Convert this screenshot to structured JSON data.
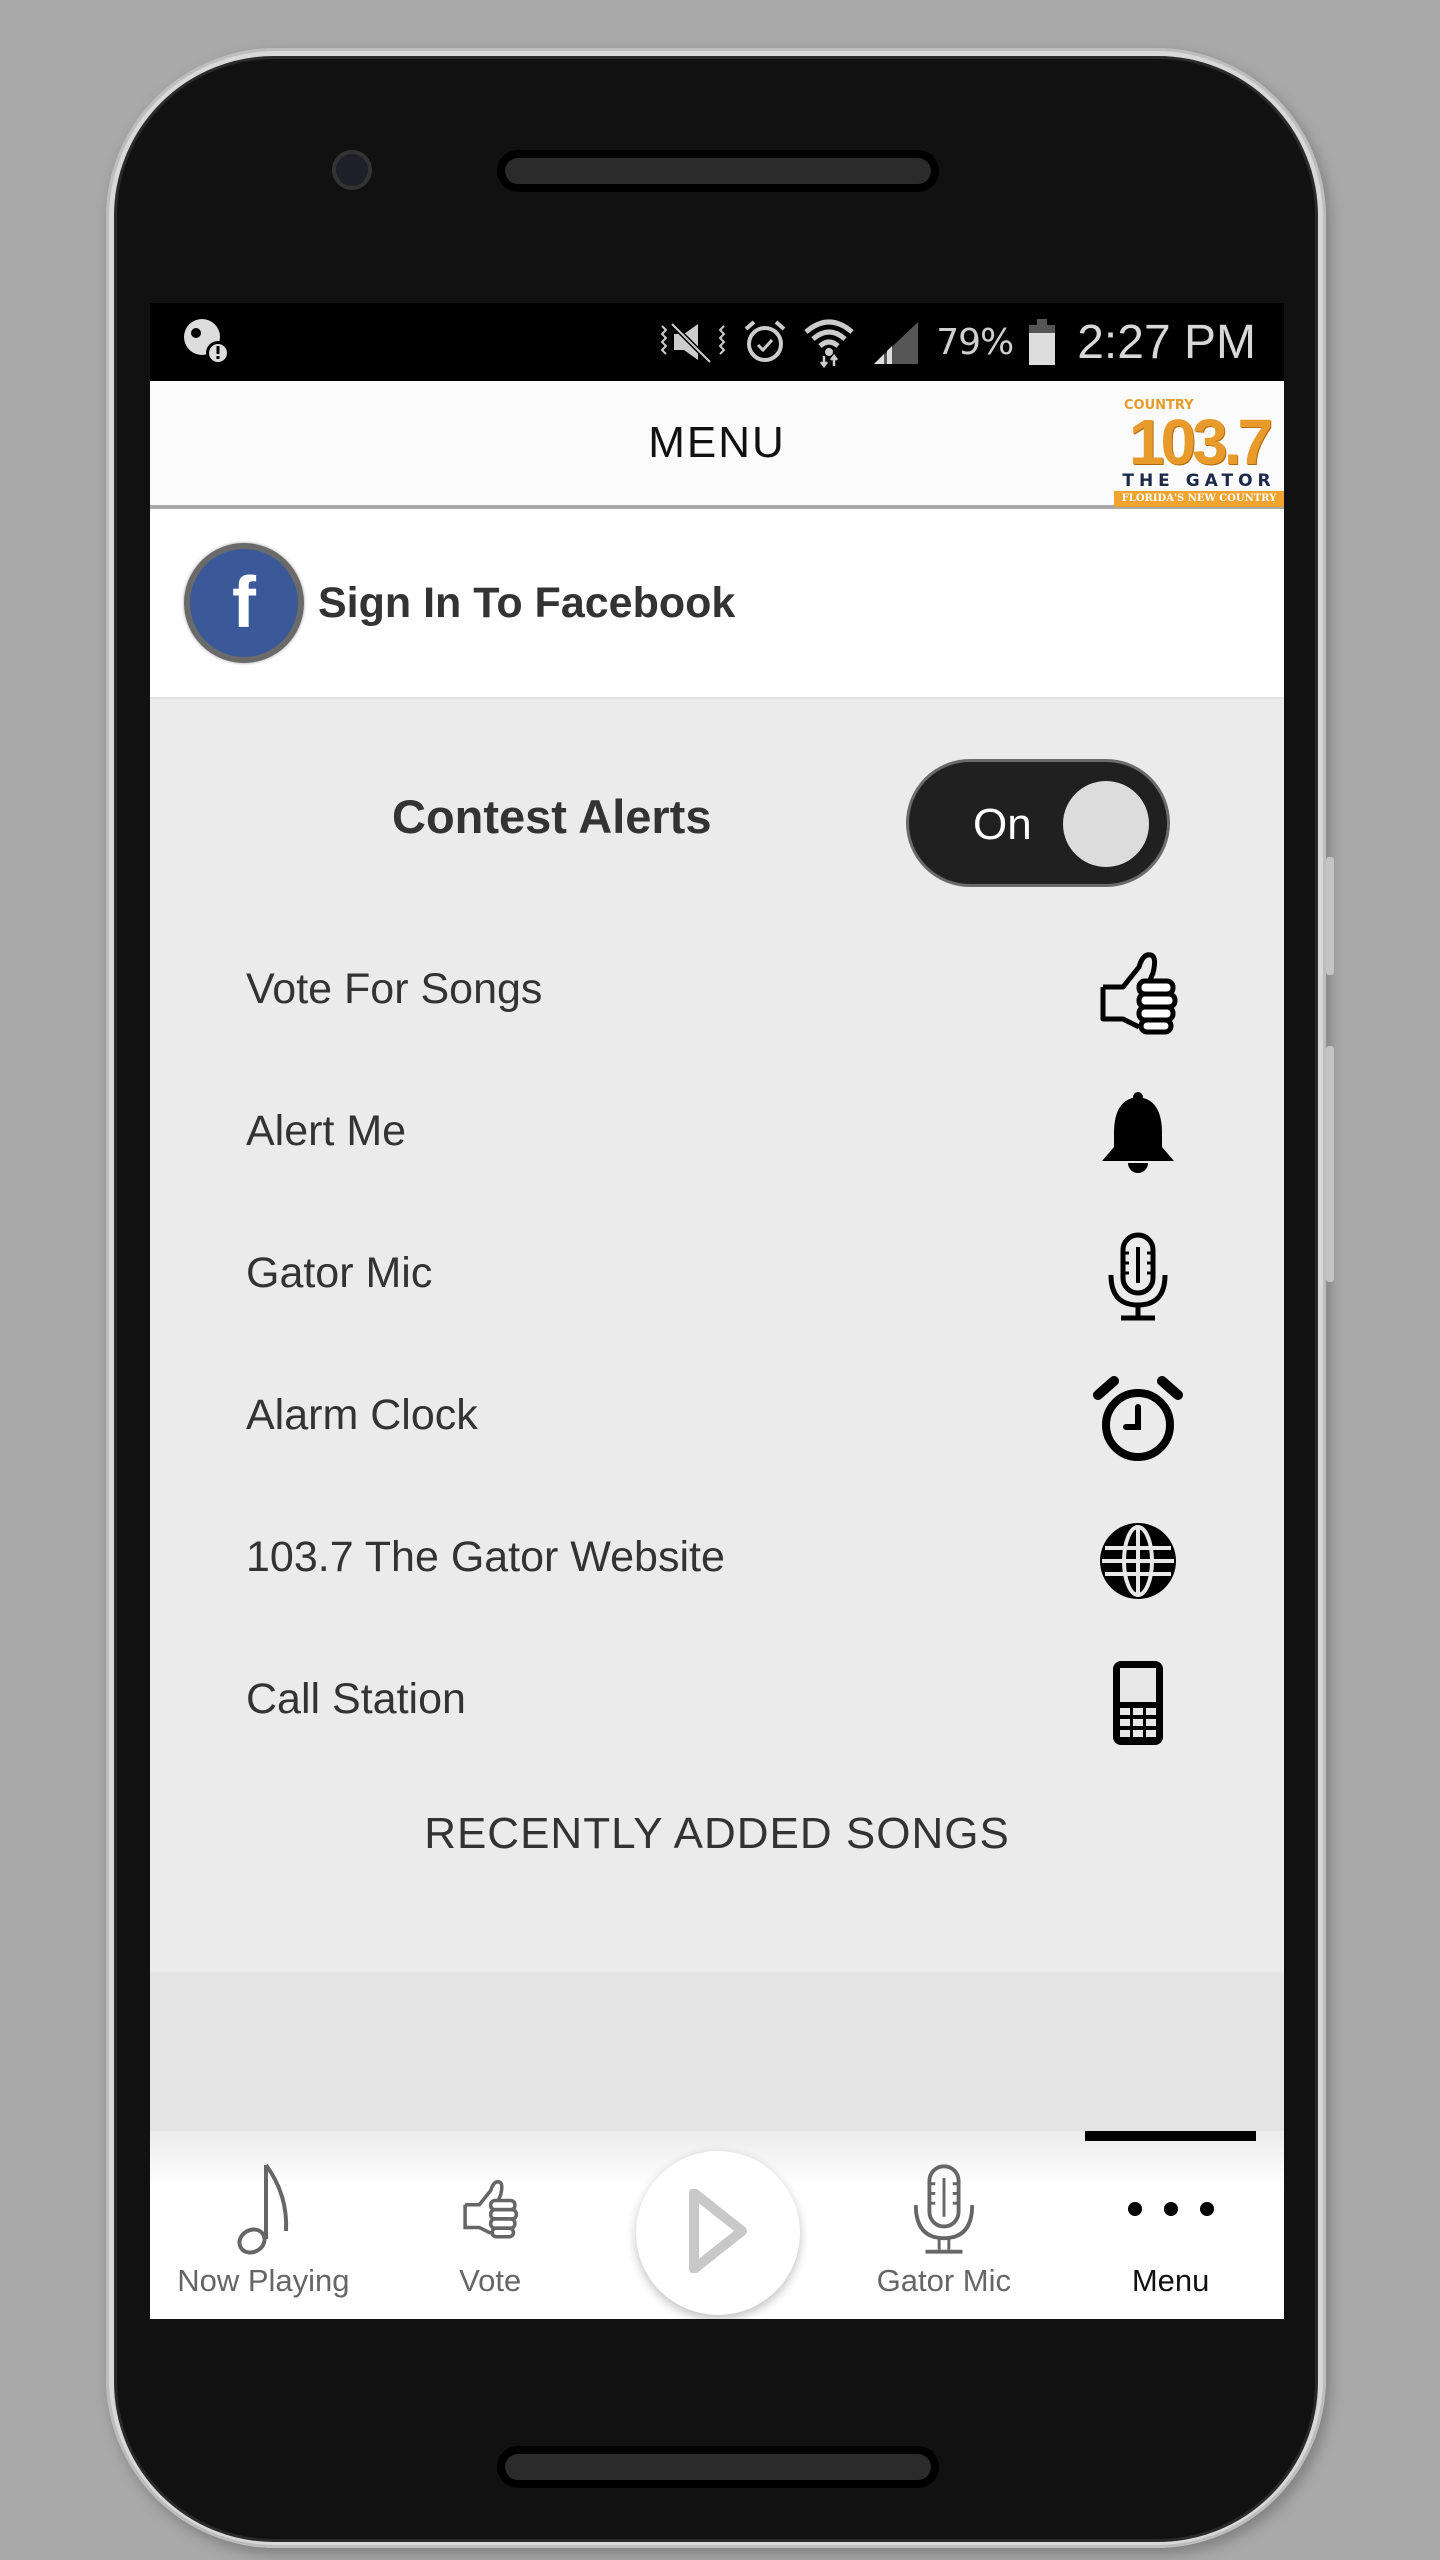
{
  "status_bar": {
    "left_icon": "data-saver-alert-icon",
    "icons": [
      "vibrate-mute-icon",
      "alarm-icon",
      "wifi-icon",
      "signal-icon"
    ],
    "battery_percent": "79%",
    "battery_icon": "battery-icon",
    "time": "2:27 PM"
  },
  "header": {
    "title": "MENU",
    "logo": {
      "country": "COUNTRY",
      "frequency": "103.7",
      "name": "THE GATOR",
      "tagline": "FLORIDA'S NEW COUNTRY"
    }
  },
  "facebook": {
    "label": "Sign In To Facebook",
    "icon_letter": "f",
    "color": "#3b5998"
  },
  "contest_alerts": {
    "label": "Contest Alerts",
    "toggle_label": "On",
    "enabled": true
  },
  "menu_items": [
    {
      "label": "Vote For Songs",
      "icon": "thumbs-up-icon"
    },
    {
      "label": "Alert Me",
      "icon": "bell-icon"
    },
    {
      "label": "Gator Mic",
      "icon": "microphone-icon"
    },
    {
      "label": "Alarm Clock",
      "icon": "alarm-clock-icon"
    },
    {
      "label": "103.7 The Gator Website",
      "icon": "globe-icon"
    },
    {
      "label": "Call Station",
      "icon": "mobile-phone-icon"
    }
  ],
  "recent_section": {
    "title": "RECENTLY ADDED SONGS"
  },
  "tab_bar": {
    "tabs": [
      {
        "label": "Now Playing",
        "icon": "music-note-icon",
        "active": false
      },
      {
        "label": "Vote",
        "icon": "thumbs-up-icon",
        "active": false
      },
      {
        "label": "",
        "icon": "play-icon",
        "active": false
      },
      {
        "label": "Gator Mic",
        "icon": "microphone-icon",
        "active": false
      },
      {
        "label": "Menu",
        "icon": "more-dots-icon",
        "active": true
      }
    ]
  }
}
